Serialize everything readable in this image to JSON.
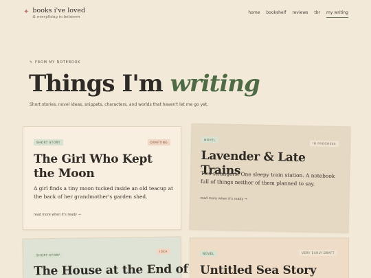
{
  "brand": {
    "title": "books i've loved",
    "tagline": "& everything in between",
    "icon": "star-icon"
  },
  "nav": {
    "items": [
      {
        "label": "home",
        "active": false
      },
      {
        "label": "bookshelf",
        "active": false
      },
      {
        "label": "reviews",
        "active": false
      },
      {
        "label": "tbr",
        "active": false
      },
      {
        "label": "my writing",
        "active": true
      }
    ]
  },
  "hero": {
    "kicker": "FROM MY NOTEBOOK",
    "title_plain": "Things I'm ",
    "title_accent": "writing",
    "subtitle": "Short stories, novel ideas, snippets, characters, and worlds that haven't let me go yet."
  },
  "cards": [
    {
      "type": "SHORT STORY",
      "status": "DRAFTING",
      "title": "The Girl Who Kept the Moon",
      "description": "A girl finds a tiny moon tucked inside an old teacup at the back of her grandmother's garden shed.",
      "link": "read more when it's ready →"
    },
    {
      "type": "NOVEL",
      "status": "IN PROGRESS",
      "title": "Lavender & Late Trains",
      "description": "Two strangers. One sleepy train station. A notebook full of things neither of them planned to say.",
      "link": "read more when it's ready →"
    },
    {
      "type": "SHORT STORY",
      "status": "IDEA",
      "title": "The House at the End of"
    },
    {
      "type": "NOVEL",
      "status": "VERY EARLY DRAFT",
      "title": "Untitled Sea Story"
    }
  ],
  "colors": {
    "background": "#f3e9d8",
    "accent_green": "#4f6b45",
    "star": "#c0756a"
  }
}
